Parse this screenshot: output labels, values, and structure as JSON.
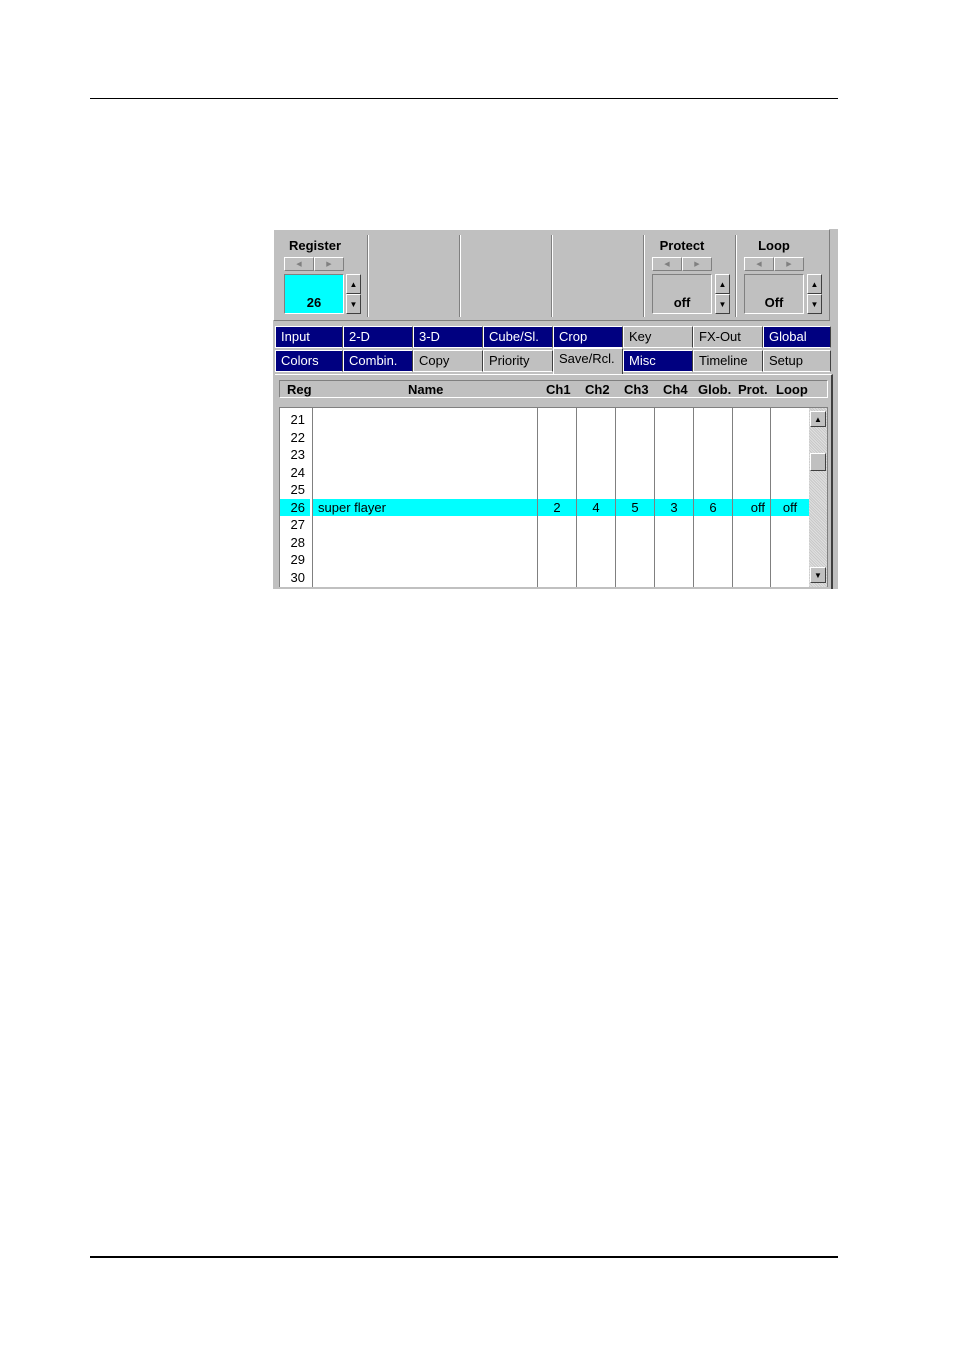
{
  "controls": {
    "register": {
      "title": "Register",
      "value": "26"
    },
    "protect": {
      "title": "Protect",
      "value": "off"
    },
    "loop": {
      "title": "Loop",
      "value": "Off"
    }
  },
  "icons": {
    "left": "◀",
    "right": "▶",
    "up": "▲",
    "down": "▼"
  },
  "tabs_row1": [
    {
      "label": "Input",
      "style": "dark"
    },
    {
      "label": "2-D",
      "style": "dark"
    },
    {
      "label": "3-D",
      "style": "dark"
    },
    {
      "label": "Cube/Sl.",
      "style": "dark"
    },
    {
      "label": "Crop",
      "style": "dark"
    },
    {
      "label": "Key",
      "style": "light"
    },
    {
      "label": "FX-Out",
      "style": "light"
    },
    {
      "label": "Global",
      "style": "dark"
    }
  ],
  "tabs_row2": [
    {
      "label": "Colors",
      "style": "dark"
    },
    {
      "label": "Combin.",
      "style": "dark"
    },
    {
      "label": "Copy",
      "style": "light"
    },
    {
      "label": "Priority",
      "style": "light"
    },
    {
      "label": "Save/Rcl.",
      "style": "active"
    },
    {
      "label": "Misc",
      "style": "dark"
    },
    {
      "label": "Timeline",
      "style": "light"
    },
    {
      "label": "Setup",
      "style": "light"
    }
  ],
  "table": {
    "headers": [
      "Reg",
      "Name",
      "Ch1",
      "Ch2",
      "Ch3",
      "Ch4",
      "Glob.",
      "Prot.",
      "Loop"
    ],
    "rows": [
      {
        "reg": "21",
        "name": "",
        "ch1": "",
        "ch2": "",
        "ch3": "",
        "ch4": "",
        "glob": "",
        "prot": "",
        "loop": ""
      },
      {
        "reg": "22",
        "name": "",
        "ch1": "",
        "ch2": "",
        "ch3": "",
        "ch4": "",
        "glob": "",
        "prot": "",
        "loop": ""
      },
      {
        "reg": "23",
        "name": "",
        "ch1": "",
        "ch2": "",
        "ch3": "",
        "ch4": "",
        "glob": "",
        "prot": "",
        "loop": ""
      },
      {
        "reg": "24",
        "name": "",
        "ch1": "",
        "ch2": "",
        "ch3": "",
        "ch4": "",
        "glob": "",
        "prot": "",
        "loop": ""
      },
      {
        "reg": "25",
        "name": "",
        "ch1": "",
        "ch2": "",
        "ch3": "",
        "ch4": "",
        "glob": "",
        "prot": "",
        "loop": ""
      },
      {
        "reg": "26",
        "name": "super flayer",
        "ch1": "2",
        "ch2": "4",
        "ch3": "5",
        "ch4": "3",
        "glob": "6",
        "prot": "off",
        "loop": "off",
        "selected": true
      },
      {
        "reg": "27",
        "name": "",
        "ch1": "",
        "ch2": "",
        "ch3": "",
        "ch4": "",
        "glob": "",
        "prot": "",
        "loop": ""
      },
      {
        "reg": "28",
        "name": "",
        "ch1": "",
        "ch2": "",
        "ch3": "",
        "ch4": "",
        "glob": "",
        "prot": "",
        "loop": ""
      },
      {
        "reg": "29",
        "name": "",
        "ch1": "",
        "ch2": "",
        "ch3": "",
        "ch4": "",
        "glob": "",
        "prot": "",
        "loop": ""
      },
      {
        "reg": "30",
        "name": "",
        "ch1": "",
        "ch2": "",
        "ch3": "",
        "ch4": "",
        "glob": "",
        "prot": "",
        "loop": ""
      }
    ]
  },
  "colors": {
    "selected": "#00ffff",
    "tab_dark": "#000080",
    "panel": "#c0c0c0"
  }
}
